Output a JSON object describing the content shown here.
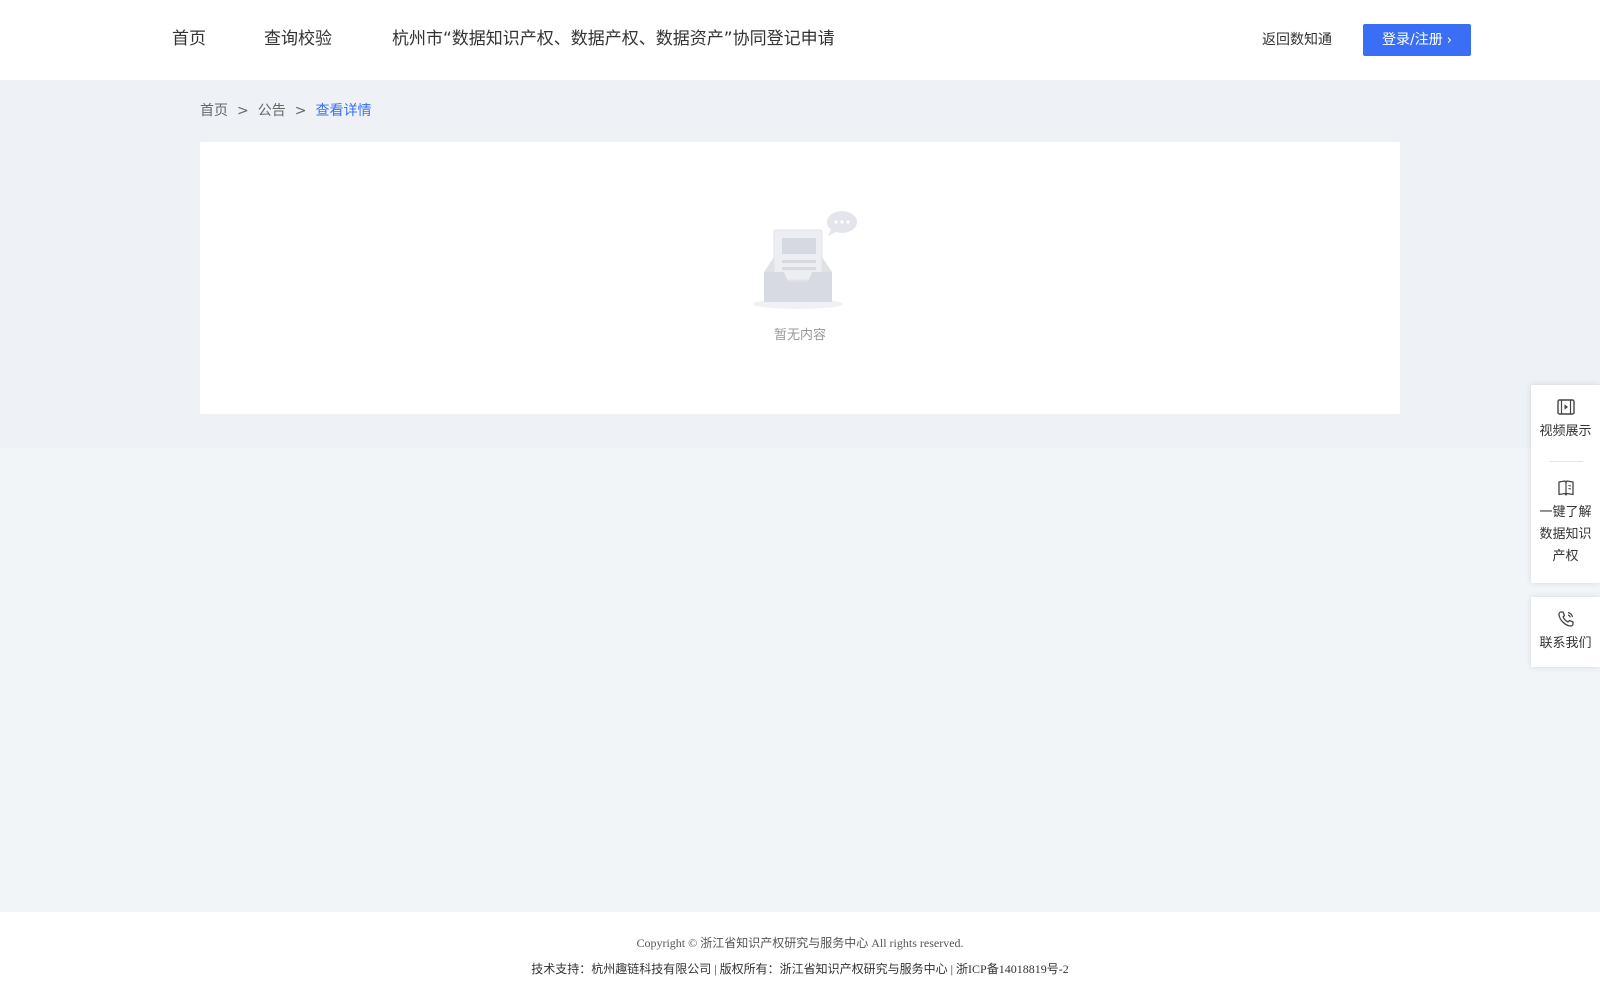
{
  "header": {
    "nav": [
      "首页",
      "查询校验",
      "杭州市“数据知识产权、数据产权、数据资产”协同登记申请"
    ],
    "back_link": "返回数知通",
    "login_label": "登录/注册"
  },
  "breadcrumb": {
    "items": [
      "首页",
      "公告",
      "查看详情"
    ],
    "separator": ">"
  },
  "content": {
    "empty_text": "暂无内容"
  },
  "floating": {
    "video": "视频展示",
    "learn_line1": "一键了解",
    "learn_line2": "数据知识",
    "learn_line3": "产权",
    "contact": "联系我们"
  },
  "footer": {
    "copyright": "Copyright © 浙江省知识产权研究与服务中心 All rights reserved.",
    "support": "技术支持：杭州趣链科技有限公司 | 版权所有：浙江省知识产权研究与服务中心 | 浙ICP备14018819号-2"
  },
  "colors": {
    "accent": "#3a6ff5",
    "page_bg": "#f2f5f8"
  },
  "icons": [
    "video-icon",
    "book-icon",
    "phone-icon",
    "empty-inbox-icon",
    "chevron-right-icon"
  ]
}
